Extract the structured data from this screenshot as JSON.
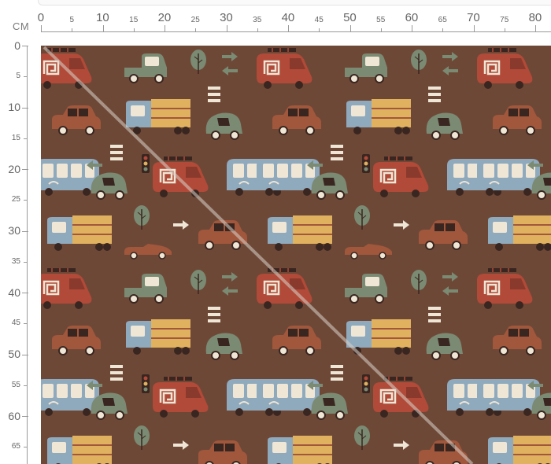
{
  "ruler": {
    "unit": "CM",
    "top_labels": [
      "0",
      "5",
      "10",
      "15",
      "20",
      "25",
      "30",
      "35",
      "40",
      "45",
      "50",
      "55",
      "60",
      "65",
      "70",
      "75",
      "80"
    ],
    "left_labels": [
      "0",
      "5",
      "10",
      "15",
      "20",
      "25",
      "30",
      "35",
      "40",
      "45",
      "50",
      "55",
      "60",
      "65"
    ]
  },
  "fabric": {
    "background_color": "#6e4837",
    "palette": {
      "fire_truck": "#b14a38",
      "car_brown": "#a1573c",
      "sage": "#7b8a72",
      "blue": "#8fa9bd",
      "yellow": "#e0b15f",
      "cream": "#efe6d6",
      "dark": "#3a2620"
    },
    "motifs": [
      "fire-truck-icon",
      "pickup-truck-icon",
      "tree-icon",
      "arrows-icon",
      "delivery-truck-icon",
      "car-icon",
      "bus-icon",
      "traffic-light-icon",
      "convertible-icon",
      "stripes-icon"
    ]
  }
}
